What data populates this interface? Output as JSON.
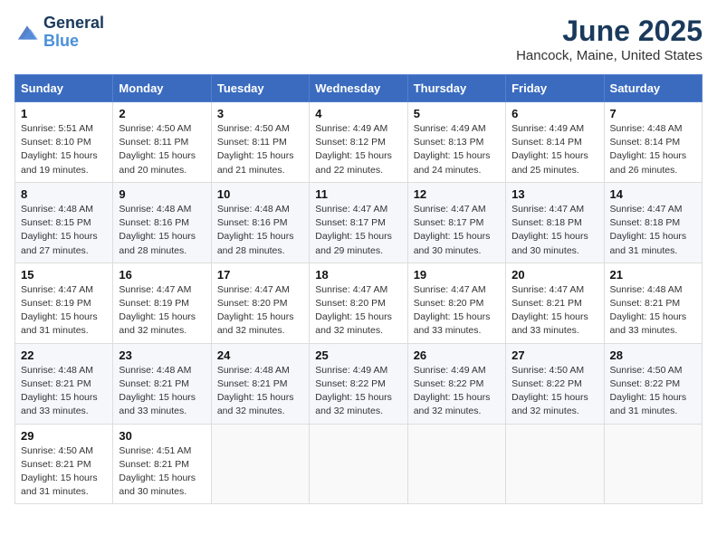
{
  "header": {
    "logo_line1": "General",
    "logo_line2": "Blue",
    "month_title": "June 2025",
    "location": "Hancock, Maine, United States"
  },
  "days_of_week": [
    "Sunday",
    "Monday",
    "Tuesday",
    "Wednesday",
    "Thursday",
    "Friday",
    "Saturday"
  ],
  "weeks": [
    [
      {
        "day": "1",
        "sunrise": "5:51 AM",
        "sunset": "8:10 PM",
        "daylight": "15 hours and 19 minutes."
      },
      {
        "day": "2",
        "sunrise": "4:50 AM",
        "sunset": "8:11 PM",
        "daylight": "15 hours and 20 minutes."
      },
      {
        "day": "3",
        "sunrise": "4:50 AM",
        "sunset": "8:11 PM",
        "daylight": "15 hours and 21 minutes."
      },
      {
        "day": "4",
        "sunrise": "4:49 AM",
        "sunset": "8:12 PM",
        "daylight": "15 hours and 22 minutes."
      },
      {
        "day": "5",
        "sunrise": "4:49 AM",
        "sunset": "8:13 PM",
        "daylight": "15 hours and 24 minutes."
      },
      {
        "day": "6",
        "sunrise": "4:49 AM",
        "sunset": "8:14 PM",
        "daylight": "15 hours and 25 minutes."
      },
      {
        "day": "7",
        "sunrise": "4:48 AM",
        "sunset": "8:14 PM",
        "daylight": "15 hours and 26 minutes."
      }
    ],
    [
      {
        "day": "8",
        "sunrise": "4:48 AM",
        "sunset": "8:15 PM",
        "daylight": "15 hours and 27 minutes."
      },
      {
        "day": "9",
        "sunrise": "4:48 AM",
        "sunset": "8:16 PM",
        "daylight": "15 hours and 28 minutes."
      },
      {
        "day": "10",
        "sunrise": "4:48 AM",
        "sunset": "8:16 PM",
        "daylight": "15 hours and 28 minutes."
      },
      {
        "day": "11",
        "sunrise": "4:47 AM",
        "sunset": "8:17 PM",
        "daylight": "15 hours and 29 minutes."
      },
      {
        "day": "12",
        "sunrise": "4:47 AM",
        "sunset": "8:17 PM",
        "daylight": "15 hours and 30 minutes."
      },
      {
        "day": "13",
        "sunrise": "4:47 AM",
        "sunset": "8:18 PM",
        "daylight": "15 hours and 30 minutes."
      },
      {
        "day": "14",
        "sunrise": "4:47 AM",
        "sunset": "8:18 PM",
        "daylight": "15 hours and 31 minutes."
      }
    ],
    [
      {
        "day": "15",
        "sunrise": "4:47 AM",
        "sunset": "8:19 PM",
        "daylight": "15 hours and 31 minutes."
      },
      {
        "day": "16",
        "sunrise": "4:47 AM",
        "sunset": "8:19 PM",
        "daylight": "15 hours and 32 minutes."
      },
      {
        "day": "17",
        "sunrise": "4:47 AM",
        "sunset": "8:20 PM",
        "daylight": "15 hours and 32 minutes."
      },
      {
        "day": "18",
        "sunrise": "4:47 AM",
        "sunset": "8:20 PM",
        "daylight": "15 hours and 32 minutes."
      },
      {
        "day": "19",
        "sunrise": "4:47 AM",
        "sunset": "8:20 PM",
        "daylight": "15 hours and 33 minutes."
      },
      {
        "day": "20",
        "sunrise": "4:47 AM",
        "sunset": "8:21 PM",
        "daylight": "15 hours and 33 minutes."
      },
      {
        "day": "21",
        "sunrise": "4:48 AM",
        "sunset": "8:21 PM",
        "daylight": "15 hours and 33 minutes."
      }
    ],
    [
      {
        "day": "22",
        "sunrise": "4:48 AM",
        "sunset": "8:21 PM",
        "daylight": "15 hours and 33 minutes."
      },
      {
        "day": "23",
        "sunrise": "4:48 AM",
        "sunset": "8:21 PM",
        "daylight": "15 hours and 33 minutes."
      },
      {
        "day": "24",
        "sunrise": "4:48 AM",
        "sunset": "8:21 PM",
        "daylight": "15 hours and 32 minutes."
      },
      {
        "day": "25",
        "sunrise": "4:49 AM",
        "sunset": "8:22 PM",
        "daylight": "15 hours and 32 minutes."
      },
      {
        "day": "26",
        "sunrise": "4:49 AM",
        "sunset": "8:22 PM",
        "daylight": "15 hours and 32 minutes."
      },
      {
        "day": "27",
        "sunrise": "4:50 AM",
        "sunset": "8:22 PM",
        "daylight": "15 hours and 32 minutes."
      },
      {
        "day": "28",
        "sunrise": "4:50 AM",
        "sunset": "8:22 PM",
        "daylight": "15 hours and 31 minutes."
      }
    ],
    [
      {
        "day": "29",
        "sunrise": "4:50 AM",
        "sunset": "8:21 PM",
        "daylight": "15 hours and 31 minutes."
      },
      {
        "day": "30",
        "sunrise": "4:51 AM",
        "sunset": "8:21 PM",
        "daylight": "15 hours and 30 minutes."
      },
      null,
      null,
      null,
      null,
      null
    ]
  ]
}
